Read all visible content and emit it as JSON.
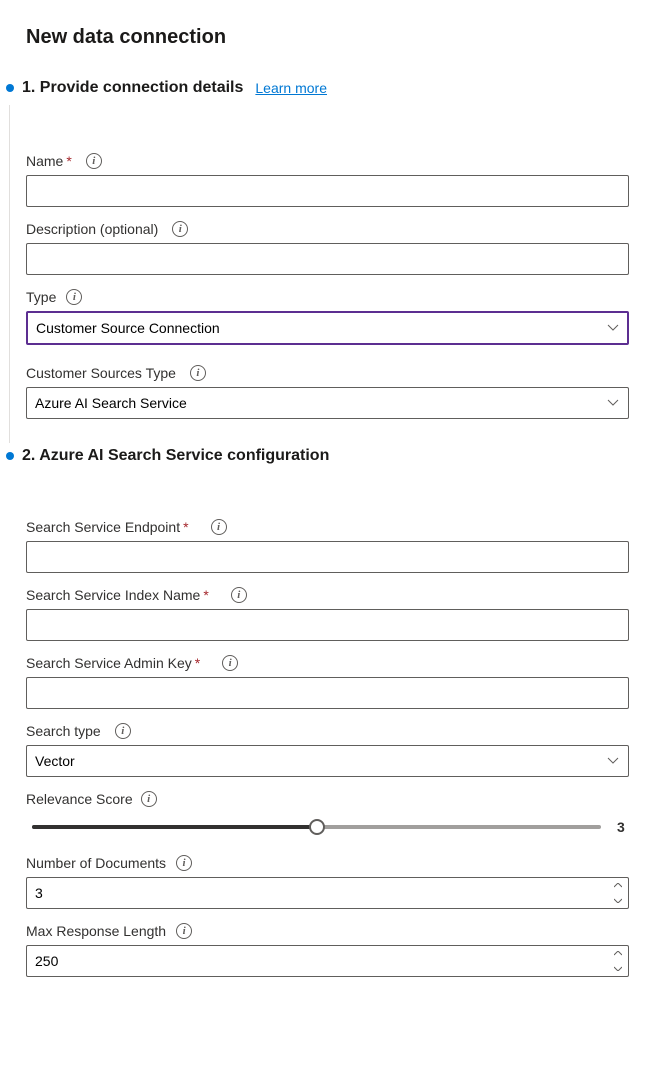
{
  "page_title": "New data connection",
  "section1": {
    "title": "1. Provide connection details",
    "learn_more": "Learn more",
    "name_label": "Name",
    "name_value": "",
    "description_label": "Description (optional)",
    "description_value": "",
    "type_label": "Type",
    "type_value": "Customer Source Connection",
    "cust_src_type_label": "Customer Sources Type",
    "cust_src_type_value": "Azure AI Search Service"
  },
  "section2": {
    "title": "2. Azure AI Search Service configuration",
    "endpoint_label": "Search Service Endpoint",
    "endpoint_value": "",
    "index_label": "Search Service Index Name",
    "index_value": "",
    "adminkey_label": "Search Service Admin Key",
    "adminkey_value": "",
    "searchtype_label": "Search type",
    "searchtype_value": "Vector",
    "relevance_label": "Relevance Score",
    "relevance_value": "3",
    "relevance_percent": 50,
    "numdocs_label": "Number of Documents",
    "numdocs_value": "3",
    "maxresp_label": "Max Response Length",
    "maxresp_value": "250"
  }
}
